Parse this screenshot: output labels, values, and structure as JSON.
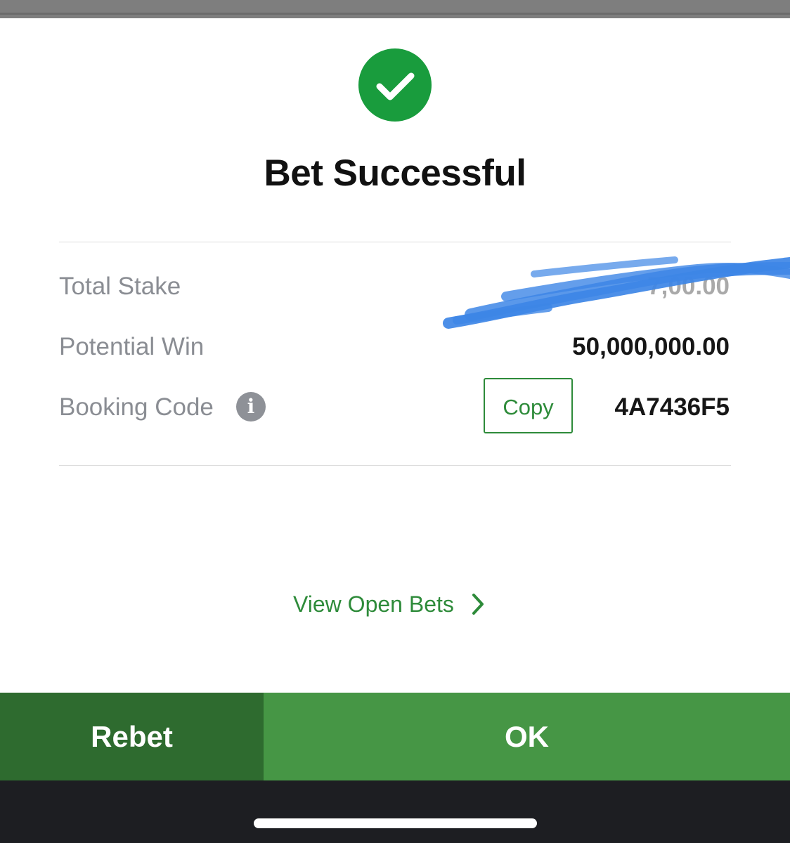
{
  "dialog": {
    "title": "Bet Successful",
    "status_icon": "check-circle-icon"
  },
  "summary": {
    "total_stake_label": "Total Stake",
    "total_stake_value": "7,00.00",
    "potential_win_label": "Potential Win",
    "potential_win_value": "50,000,000.00",
    "booking_code_label": "Booking Code",
    "booking_code_value": "4A7436F5",
    "copy_label": "Copy",
    "info_icon": "info-icon",
    "info_glyph": "i"
  },
  "links": {
    "view_open_bets": "View Open Bets",
    "chevron_icon": "chevron-right-icon"
  },
  "actions": {
    "rebet_label": "Rebet",
    "ok_label": "OK"
  },
  "colors": {
    "success_green": "#199c3d",
    "link_green": "#2e8b3a",
    "rebet_bg": "#2e6b2f",
    "ok_bg": "#469645",
    "scribble_blue": "#3d86e6",
    "label_gray": "#8a8d93"
  }
}
